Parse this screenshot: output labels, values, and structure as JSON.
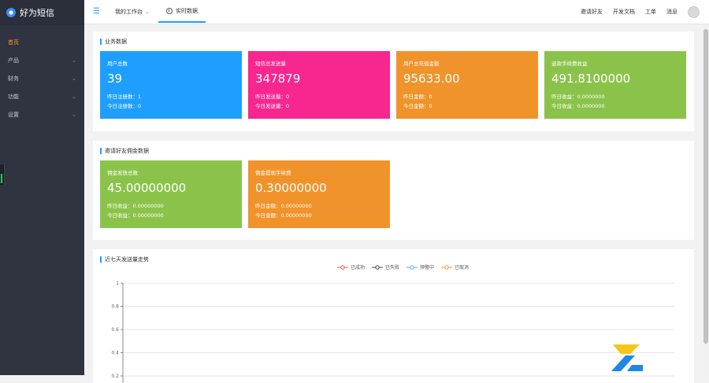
{
  "app": {
    "name": "好为短信"
  },
  "sidebar": {
    "items": [
      {
        "label": "首页"
      },
      {
        "label": "产品"
      },
      {
        "label": "财务"
      },
      {
        "label": "功能"
      },
      {
        "label": "设置"
      }
    ]
  },
  "header": {
    "tabs": [
      {
        "label": "我的工作台"
      },
      {
        "label": "实时数据"
      }
    ],
    "right_links": [
      "邀请好友",
      "开发文档",
      "工单",
      "消息"
    ]
  },
  "business": {
    "title": "业务数据",
    "cards": [
      {
        "title": "用户总数",
        "value": "39",
        "line1": "昨日注册数：1",
        "line2": "今日注册数：0",
        "color": "#1e9fff"
      },
      {
        "title": "短信总发送量",
        "value": "347879",
        "line1": "昨日发送量：0",
        "line2": "今日发送量：0",
        "color": "#f8268f"
      },
      {
        "title": "用户总充值金额",
        "value": "95633.00",
        "line1": "昨日金额：0",
        "line2": "今日金额：0",
        "color": "#f0932b"
      },
      {
        "title": "退款手续费收益",
        "value": "491.8100000",
        "line1": "昨日收益：0.0000000",
        "line2": "今日收益：0.0000000",
        "color": "#8bc34a"
      }
    ]
  },
  "invite": {
    "title": "邀请好友佣金数据",
    "cards": [
      {
        "title": "佣金发放总数",
        "value": "45.00000000",
        "line1": "昨日收益：0.00000000",
        "line2": "今日收益：0.00000000",
        "color": "#8bc34a"
      },
      {
        "title": "佣金提现手续费",
        "value": "0.30000000",
        "line1": "昨日金额：0.00000000",
        "line2": "今日金额：0.00000000",
        "color": "#f0932b"
      }
    ]
  },
  "chart_data": {
    "type": "line",
    "title": "近七天发送量走势",
    "series": [
      {
        "name": "已成功",
        "color": "#e05a4f",
        "values": []
      },
      {
        "name": "已失败",
        "color": "#3d4a5c",
        "values": []
      },
      {
        "name": "预警中",
        "color": "#4fb3d9",
        "values": []
      },
      {
        "name": "已取消",
        "color": "#f0932b",
        "values": []
      }
    ],
    "y_ticks": [
      "1",
      "0.8",
      "0.6",
      "0.4",
      "0.2"
    ],
    "ylim": [
      0,
      1
    ],
    "grid": true,
    "legend_position": "top-center"
  }
}
